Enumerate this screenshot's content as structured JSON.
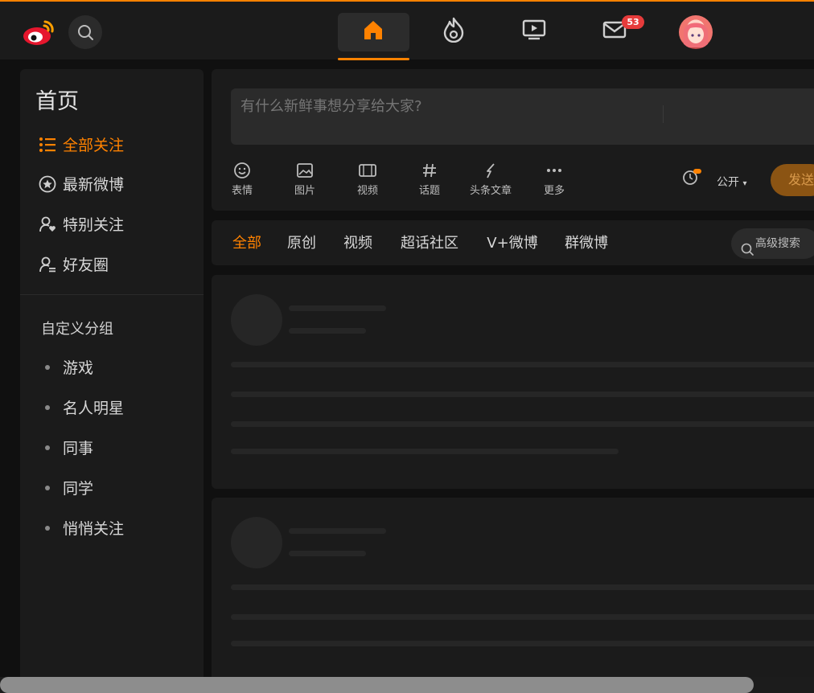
{
  "colors": {
    "accent": "#ff8200",
    "background": "#101010",
    "panel": "#1b1b1b",
    "badge": "#e63b3b"
  },
  "topbar": {
    "logo_icon": "weibo-logo-icon",
    "search_icon": "search-icon",
    "nav": [
      {
        "name": "home",
        "icon": "home-icon"
      },
      {
        "name": "hot",
        "icon": "fire-icon"
      },
      {
        "name": "video",
        "icon": "video-icon"
      },
      {
        "name": "messages",
        "icon": "mail-icon"
      },
      {
        "name": "profile",
        "icon": "avatar"
      }
    ],
    "message_badge": "53"
  },
  "sidebar": {
    "title": "首页",
    "items": [
      {
        "label": "全部关注",
        "icon": "list-icon"
      },
      {
        "label": "最新微博",
        "icon": "star-circle-icon"
      },
      {
        "label": "特别关注",
        "icon": "user-heart-icon"
      },
      {
        "label": "好友圈",
        "icon": "user-group-icon"
      }
    ],
    "group_title": "自定义分组",
    "groups": [
      {
        "label": "游戏"
      },
      {
        "label": "名人明星"
      },
      {
        "label": "同事"
      },
      {
        "label": "同学"
      },
      {
        "label": "悄悄关注"
      }
    ]
  },
  "composer": {
    "placeholder": "有什么新鲜事想分享给大家?",
    "tools": [
      {
        "label": "表情",
        "icon": "emoji-icon"
      },
      {
        "label": "图片",
        "icon": "image-icon"
      },
      {
        "label": "视频",
        "icon": "video-icon"
      },
      {
        "label": "话题",
        "icon": "hashtag-icon"
      },
      {
        "label": "头条文章",
        "icon": "article-icon"
      },
      {
        "label": "更多",
        "icon": "more-icon"
      }
    ],
    "schedule_icon": "clock-icon",
    "visibility": "公开",
    "send": "发送"
  },
  "filter_tabs": [
    {
      "label": "全部"
    },
    {
      "label": "原创"
    },
    {
      "label": "视频"
    },
    {
      "label": "超话社区"
    },
    {
      "label": "V+微博"
    },
    {
      "label": "群微博"
    }
  ],
  "advanced_search": "高级搜索"
}
